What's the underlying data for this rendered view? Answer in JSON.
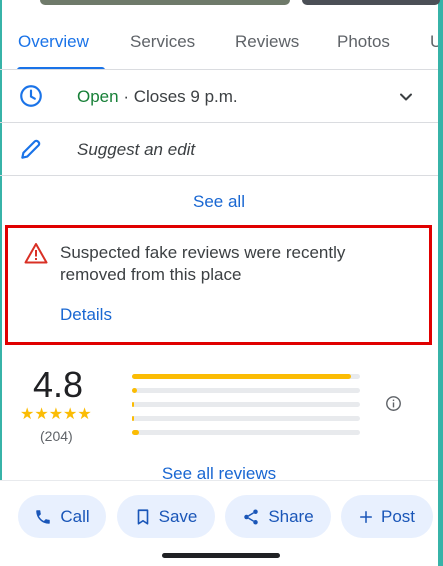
{
  "tabs": [
    {
      "label": "Overview",
      "active": true
    },
    {
      "label": "Services",
      "active": false
    },
    {
      "label": "Reviews",
      "active": false
    },
    {
      "label": "Photos",
      "active": false
    },
    {
      "label": "U",
      "active": false
    }
  ],
  "hours": {
    "status": "Open",
    "separator": " · ",
    "closes": "Closes 9 p.m.",
    "icon": "clock-icon"
  },
  "suggest_edit": {
    "label": "Suggest an edit",
    "icon": "pencil-icon"
  },
  "see_all": "See all",
  "alert": {
    "message": "Suspected fake reviews were recently removed from this place",
    "details": "Details",
    "icon": "warning-icon",
    "highlight_color": "#e00000"
  },
  "rating": {
    "score": "4.8",
    "stars": "★★★★★",
    "count": "(204)",
    "distribution": [
      0.96,
      0.02,
      0.01,
      0.01,
      0.03
    ]
  },
  "see_all_reviews": "See all reviews",
  "actions": [
    {
      "label": "Call",
      "icon": "phone-icon"
    },
    {
      "label": "Save",
      "icon": "bookmark-icon"
    },
    {
      "label": "Share",
      "icon": "share-icon"
    },
    {
      "label": "Post",
      "icon": "plus-icon"
    }
  ],
  "colors": {
    "accent": "#1a73e8",
    "open": "#188038",
    "star": "#fbbc04",
    "chip_bg": "#e8f0fe"
  }
}
